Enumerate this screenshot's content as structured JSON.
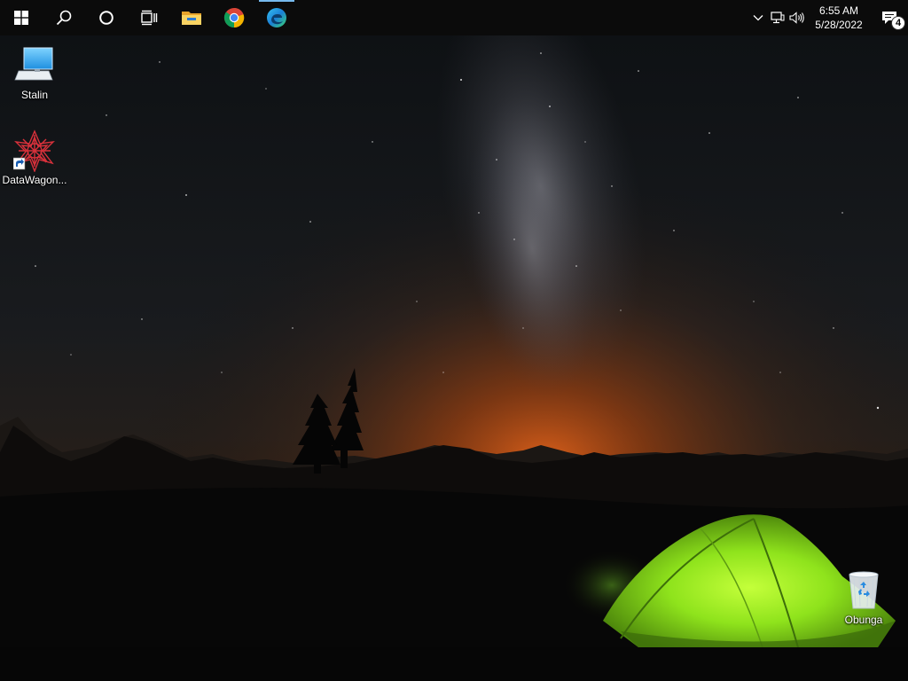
{
  "taskbar": {
    "buttons": [
      {
        "name": "start-button",
        "icon": "windows-logo-icon"
      },
      {
        "name": "search-button",
        "icon": "search-icon"
      },
      {
        "name": "cortana-button",
        "icon": "cortana-circle-icon"
      },
      {
        "name": "task-view-button",
        "icon": "task-view-icon"
      },
      {
        "name": "file-explorer-button",
        "icon": "folder-icon"
      },
      {
        "name": "chrome-button",
        "icon": "chrome-icon"
      },
      {
        "name": "edge-button",
        "icon": "edge-icon",
        "active": true
      }
    ],
    "tray": {
      "time": "6:55 AM",
      "date": "5/28/2022",
      "notification_count": "4"
    }
  },
  "desktop": {
    "icons": [
      {
        "label": "Stalin",
        "icon": "computer-icon"
      },
      {
        "label": "DataWagon...",
        "icon": "shortcut-app-icon"
      },
      {
        "label": "Obunga",
        "icon": "recycle-bin-icon"
      }
    ]
  },
  "colors": {
    "taskbar_bg": "#0b0b0b",
    "accent": "#76b9ed",
    "tent_green": "#8fe31c",
    "horizon_orange": "#e2621a"
  }
}
